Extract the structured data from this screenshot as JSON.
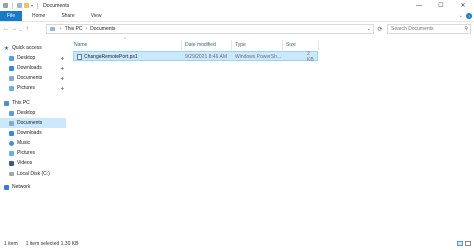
{
  "window": {
    "title": "Documents",
    "controls": {
      "minimize": "—",
      "maximize": "☐",
      "close": "✕"
    }
  },
  "ribbon": {
    "file": "File",
    "tabs": [
      "Home",
      "Share",
      "View"
    ],
    "expand": "⌄",
    "help": "?"
  },
  "address": {
    "back": "←",
    "forward": "→",
    "recent": "⌄",
    "up": "↑",
    "crumbs": [
      "This PC",
      "Documents"
    ],
    "separator": "›",
    "dropdown": "⌄",
    "refresh": "⟳",
    "search_placeholder": "Search Documents",
    "search_icon": "⚲"
  },
  "nav": {
    "quick_access": "Quick access",
    "quick_items": [
      {
        "label": "Desktop",
        "pinned": true,
        "color": "#5aa0e0"
      },
      {
        "label": "Downloads",
        "pinned": true,
        "color": "#3a8ad8"
      },
      {
        "label": "Documents",
        "pinned": true,
        "color": "#8aa8c8"
      },
      {
        "label": "Pictures",
        "pinned": true,
        "color": "#6ab0d8"
      }
    ],
    "this_pc": "This PC",
    "pc_items": [
      {
        "label": "Desktop",
        "selected": false,
        "color": "#5aa0e0"
      },
      {
        "label": "Documents",
        "selected": true,
        "color": "#8aa8c8"
      },
      {
        "label": "Downloads",
        "selected": false,
        "color": "#3a8ad8"
      },
      {
        "label": "Music",
        "selected": false,
        "color": "#4a90d0"
      },
      {
        "label": "Pictures",
        "selected": false,
        "color": "#6ab0d8"
      },
      {
        "label": "Videos",
        "selected": false,
        "color": "#3a5a8a"
      },
      {
        "label": "Local Disk (C:)",
        "selected": false,
        "color": "#9aa8b8"
      }
    ],
    "network": "Network",
    "pin_glyph": "📌"
  },
  "columns": {
    "name": "Name",
    "date": "Date modified",
    "type": "Type",
    "size": "Size",
    "sort_glyph": "^"
  },
  "files": [
    {
      "name": "ChangeRemotePort.ps1",
      "date": "9/29/2021 8:46 AM",
      "type": "Windows PowerSh...",
      "size": "2 KB"
    }
  ],
  "status": {
    "count": "1 item",
    "selected": "1 item selected  1.30 KB"
  },
  "colors": {
    "accent": "#1979ca",
    "selection": "#cce8ff",
    "selection_border": "#99d1ff"
  }
}
